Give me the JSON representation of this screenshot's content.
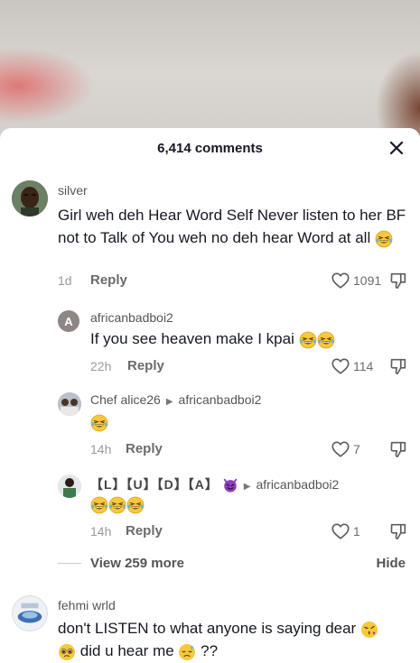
{
  "header": {
    "title": "6,414 comments"
  },
  "comments": [
    {
      "username": "silver",
      "text": "Girl weh deh Hear Word Self Never listen to her BF not to Talk of You weh no deh hear Word at all",
      "age": "1d",
      "reply_label": "Reply",
      "likes": "1091",
      "replies": [
        {
          "username": "africanbadboi2",
          "avatar_letter": "A",
          "text": "If you see heaven make I kpai",
          "age": "22h",
          "reply_label": "Reply",
          "likes": "114"
        },
        {
          "username": "Chef alice26",
          "reply_to": "africanbadboi2",
          "text": "",
          "age": "14h",
          "reply_label": "Reply",
          "likes": "7"
        },
        {
          "username": "【L】【U】【D】【A】",
          "reply_to": "africanbadboi2",
          "text": "",
          "age": "14h",
          "reply_label": "Reply",
          "likes": "1"
        }
      ],
      "view_more": "View 259 more",
      "hide_label": "Hide"
    },
    {
      "username": "fehmi wrld",
      "text": "don't LISTEN to what anyone is saying dear",
      "text2": "did u hear me",
      "text3": "??"
    }
  ],
  "icons": [
    "close-icon",
    "heart-outline-icon",
    "dislike-icon",
    "laughing-emoji",
    "devil-emoji",
    "pleading-emoji",
    "sad-emoji",
    "kiss-emoji"
  ],
  "colors": {
    "emoji_yellow": "#f6c83b",
    "devil_purple": "#8a3fb8",
    "text": "#161823",
    "muted": "#9a9a9a"
  }
}
